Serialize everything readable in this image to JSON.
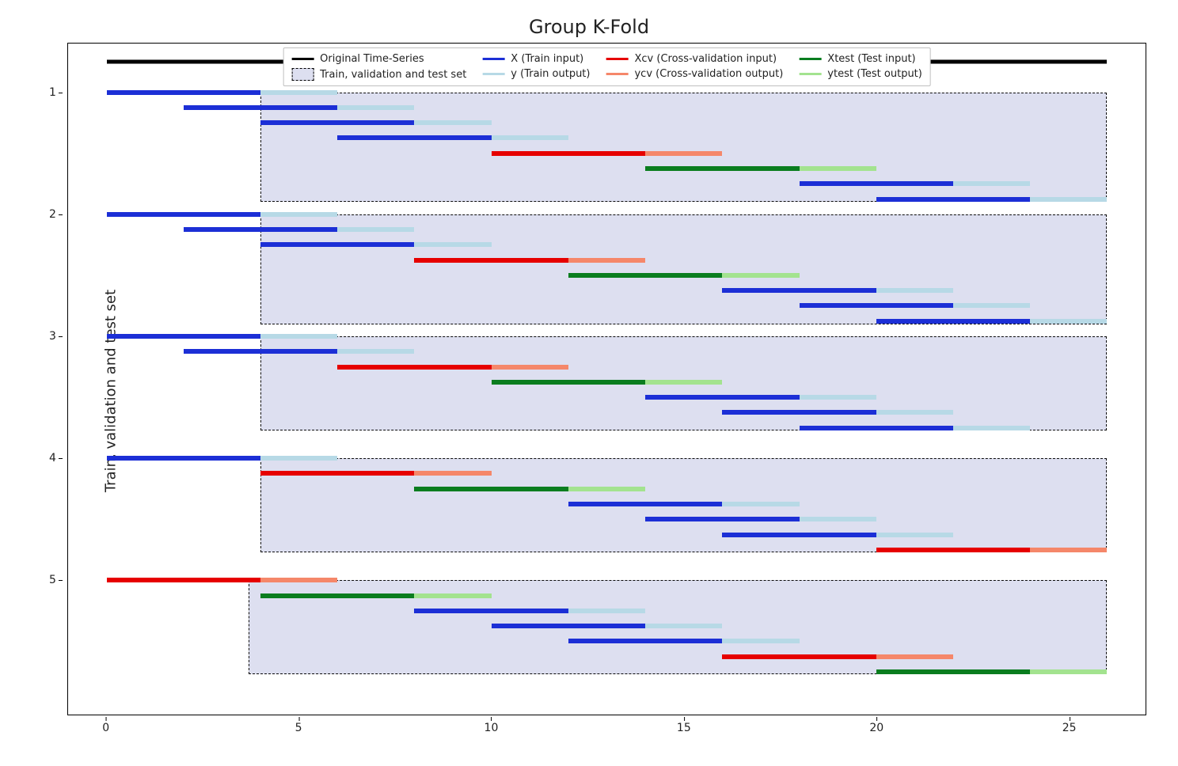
{
  "chart_data": {
    "type": "other",
    "title": "Group K-Fold",
    "ylabel": "Train, validation and test set",
    "xlabel": "",
    "x_ticks": [
      0,
      5,
      10,
      15,
      20,
      25
    ],
    "x_range": [
      -1,
      27
    ],
    "y_ticks": [
      1,
      2,
      3,
      4,
      5
    ],
    "y_range": [
      0.6,
      6.1
    ],
    "legend": [
      {
        "kind": "line",
        "color": "#000000",
        "label": "Original Time-Series"
      },
      {
        "kind": "box",
        "fill": "#dddff0",
        "label": "Train, validation and test set"
      },
      {
        "kind": "line",
        "color": "#1c2fd6",
        "label": "X (Train input)"
      },
      {
        "kind": "line",
        "color": "#b7d9e6",
        "label": "y (Train output)"
      },
      {
        "kind": "line",
        "color": "#e60000",
        "label": "Xcv (Cross-validation input)"
      },
      {
        "kind": "line",
        "color": "#f5876a",
        "label": "ycv (Cross-validation output)"
      },
      {
        "kind": "line",
        "color": "#0a7d1f",
        "label": "Xtest (Test input)"
      },
      {
        "kind": "line",
        "color": "#a3e38f",
        "label": "ytest (Test output)"
      }
    ],
    "colors": {
      "original": "#000000",
      "box_fill": "#dddff0",
      "X": "#1c2fd6",
      "y": "#b7d9e6",
      "Xcv": "#e60000",
      "ycv": "#f5876a",
      "Xtest": "#0a7d1f",
      "ytest": "#a3e38f"
    },
    "window_len_input": 4,
    "window_len_output": 2,
    "original_series": {
      "y": 0.75,
      "x0": 0,
      "x1": 26
    },
    "fold_boxes": [
      {
        "y_top": 1.0,
        "y_bot": 1.9,
        "x0": 4,
        "x1": 26
      },
      {
        "y_top": 2.0,
        "y_bot": 2.9,
        "x0": 4,
        "x1": 26
      },
      {
        "y_top": 3.0,
        "y_bot": 3.77,
        "x0": 4,
        "x1": 26
      },
      {
        "y_top": 4.0,
        "y_bot": 4.77,
        "x0": 4,
        "x1": 26
      },
      {
        "y_top": 5.0,
        "y_bot": 5.77,
        "x0": 3.7,
        "x1": 26
      }
    ],
    "segments": [
      {
        "fold": 1,
        "row": 0,
        "x0": 0,
        "role": "X"
      },
      {
        "fold": 1,
        "row": 0,
        "x0": 4,
        "role": "y"
      },
      {
        "fold": 1,
        "row": 1,
        "x0": 2,
        "role": "X"
      },
      {
        "fold": 1,
        "row": 1,
        "x0": 6,
        "role": "y"
      },
      {
        "fold": 1,
        "row": 2,
        "x0": 4,
        "role": "X"
      },
      {
        "fold": 1,
        "row": 2,
        "x0": 8,
        "role": "y"
      },
      {
        "fold": 1,
        "row": 3,
        "x0": 6,
        "role": "X"
      },
      {
        "fold": 1,
        "row": 3,
        "x0": 10,
        "role": "y"
      },
      {
        "fold": 1,
        "row": 4,
        "x0": 10,
        "role": "Xcv"
      },
      {
        "fold": 1,
        "row": 4,
        "x0": 14,
        "role": "ycv"
      },
      {
        "fold": 1,
        "row": 5,
        "x0": 14,
        "role": "Xtest"
      },
      {
        "fold": 1,
        "row": 5,
        "x0": 18,
        "role": "ytest"
      },
      {
        "fold": 1,
        "row": 6,
        "x0": 18,
        "role": "X"
      },
      {
        "fold": 1,
        "row": 6,
        "x0": 22,
        "role": "y"
      },
      {
        "fold": 1,
        "row": 7,
        "x0": 20,
        "role": "X"
      },
      {
        "fold": 1,
        "row": 7,
        "x0": 24,
        "role": "y"
      },
      {
        "fold": 2,
        "row": 0,
        "x0": 0,
        "role": "X"
      },
      {
        "fold": 2,
        "row": 0,
        "x0": 4,
        "role": "y"
      },
      {
        "fold": 2,
        "row": 1,
        "x0": 2,
        "role": "X"
      },
      {
        "fold": 2,
        "row": 1,
        "x0": 6,
        "role": "y"
      },
      {
        "fold": 2,
        "row": 2,
        "x0": 4,
        "role": "X"
      },
      {
        "fold": 2,
        "row": 2,
        "x0": 8,
        "role": "y"
      },
      {
        "fold": 2,
        "row": 3,
        "x0": 8,
        "role": "Xcv"
      },
      {
        "fold": 2,
        "row": 3,
        "x0": 12,
        "role": "ycv"
      },
      {
        "fold": 2,
        "row": 4,
        "x0": 12,
        "role": "Xtest"
      },
      {
        "fold": 2,
        "row": 4,
        "x0": 16,
        "role": "ytest"
      },
      {
        "fold": 2,
        "row": 5,
        "x0": 16,
        "role": "X"
      },
      {
        "fold": 2,
        "row": 5,
        "x0": 20,
        "role": "y"
      },
      {
        "fold": 2,
        "row": 6,
        "x0": 18,
        "role": "X"
      },
      {
        "fold": 2,
        "row": 6,
        "x0": 22,
        "role": "y"
      },
      {
        "fold": 2,
        "row": 7,
        "x0": 20,
        "role": "X"
      },
      {
        "fold": 2,
        "row": 7,
        "x0": 24,
        "role": "y"
      },
      {
        "fold": 3,
        "row": 0,
        "x0": 0,
        "role": "X"
      },
      {
        "fold": 3,
        "row": 0,
        "x0": 4,
        "role": "y"
      },
      {
        "fold": 3,
        "row": 1,
        "x0": 2,
        "role": "X"
      },
      {
        "fold": 3,
        "row": 1,
        "x0": 6,
        "role": "y"
      },
      {
        "fold": 3,
        "row": 2,
        "x0": 6,
        "role": "Xcv"
      },
      {
        "fold": 3,
        "row": 2,
        "x0": 10,
        "role": "ycv"
      },
      {
        "fold": 3,
        "row": 3,
        "x0": 10,
        "role": "Xtest"
      },
      {
        "fold": 3,
        "row": 3,
        "x0": 14,
        "role": "ytest"
      },
      {
        "fold": 3,
        "row": 4,
        "x0": 14,
        "role": "X"
      },
      {
        "fold": 3,
        "row": 4,
        "x0": 18,
        "role": "y"
      },
      {
        "fold": 3,
        "row": 5,
        "x0": 16,
        "role": "X"
      },
      {
        "fold": 3,
        "row": 5,
        "x0": 20,
        "role": "y"
      },
      {
        "fold": 3,
        "row": 6,
        "x0": 18,
        "role": "X"
      },
      {
        "fold": 3,
        "row": 6,
        "x0": 22,
        "role": "y"
      },
      {
        "fold": 4,
        "row": 0,
        "x0": 0,
        "role": "X"
      },
      {
        "fold": 4,
        "row": 0,
        "x0": 4,
        "role": "y"
      },
      {
        "fold": 4,
        "row": 1,
        "x0": 4,
        "role": "Xcv"
      },
      {
        "fold": 4,
        "row": 1,
        "x0": 8,
        "role": "ycv"
      },
      {
        "fold": 4,
        "row": 2,
        "x0": 8,
        "role": "Xtest"
      },
      {
        "fold": 4,
        "row": 2,
        "x0": 12,
        "role": "ytest"
      },
      {
        "fold": 4,
        "row": 3,
        "x0": 12,
        "role": "X"
      },
      {
        "fold": 4,
        "row": 3,
        "x0": 16,
        "role": "y"
      },
      {
        "fold": 4,
        "row": 4,
        "x0": 14,
        "role": "X"
      },
      {
        "fold": 4,
        "row": 4,
        "x0": 18,
        "role": "y"
      },
      {
        "fold": 4,
        "row": 5,
        "x0": 16,
        "role": "X"
      },
      {
        "fold": 4,
        "row": 5,
        "x0": 20,
        "role": "y"
      },
      {
        "fold": 4,
        "row": 6,
        "x0": 20,
        "role": "Xcv"
      },
      {
        "fold": 4,
        "row": 6,
        "x0": 24,
        "role": "ycv"
      },
      {
        "fold": 5,
        "row": 0,
        "x0": 0,
        "role": "Xcv"
      },
      {
        "fold": 5,
        "row": 0,
        "x0": 4,
        "role": "ycv"
      },
      {
        "fold": 5,
        "row": 1,
        "x0": 4,
        "role": "Xtest"
      },
      {
        "fold": 5,
        "row": 1,
        "x0": 8,
        "role": "ytest"
      },
      {
        "fold": 5,
        "row": 2,
        "x0": 8,
        "role": "X"
      },
      {
        "fold": 5,
        "row": 2,
        "x0": 12,
        "role": "y"
      },
      {
        "fold": 5,
        "row": 3,
        "x0": 10,
        "role": "X"
      },
      {
        "fold": 5,
        "row": 3,
        "x0": 14,
        "role": "y"
      },
      {
        "fold": 5,
        "row": 4,
        "x0": 12,
        "role": "X"
      },
      {
        "fold": 5,
        "row": 4,
        "x0": 16,
        "role": "y"
      },
      {
        "fold": 5,
        "row": 5,
        "x0": 16,
        "role": "Xcv"
      },
      {
        "fold": 5,
        "row": 5,
        "x0": 20,
        "role": "ycv"
      },
      {
        "fold": 5,
        "row": 6,
        "x0": 20,
        "role": "Xtest"
      },
      {
        "fold": 5,
        "row": 6,
        "x0": 24,
        "role": "ytest"
      }
    ]
  }
}
